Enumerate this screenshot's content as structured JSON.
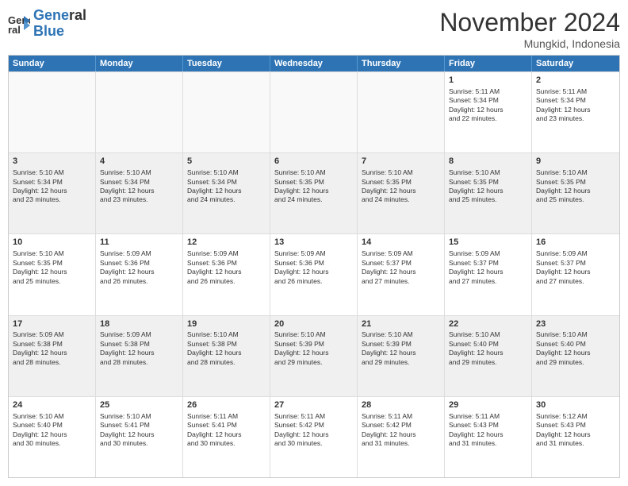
{
  "header": {
    "logo_line1": "General",
    "logo_line2": "Blue",
    "month_title": "November 2024",
    "location": "Mungkid, Indonesia"
  },
  "weekdays": [
    "Sunday",
    "Monday",
    "Tuesday",
    "Wednesday",
    "Thursday",
    "Friday",
    "Saturday"
  ],
  "rows": [
    [
      {
        "day": "",
        "info": ""
      },
      {
        "day": "",
        "info": ""
      },
      {
        "day": "",
        "info": ""
      },
      {
        "day": "",
        "info": ""
      },
      {
        "day": "",
        "info": ""
      },
      {
        "day": "1",
        "info": "Sunrise: 5:11 AM\nSunset: 5:34 PM\nDaylight: 12 hours\nand 22 minutes."
      },
      {
        "day": "2",
        "info": "Sunrise: 5:11 AM\nSunset: 5:34 PM\nDaylight: 12 hours\nand 23 minutes."
      }
    ],
    [
      {
        "day": "3",
        "info": "Sunrise: 5:10 AM\nSunset: 5:34 PM\nDaylight: 12 hours\nand 23 minutes."
      },
      {
        "day": "4",
        "info": "Sunrise: 5:10 AM\nSunset: 5:34 PM\nDaylight: 12 hours\nand 23 minutes."
      },
      {
        "day": "5",
        "info": "Sunrise: 5:10 AM\nSunset: 5:34 PM\nDaylight: 12 hours\nand 24 minutes."
      },
      {
        "day": "6",
        "info": "Sunrise: 5:10 AM\nSunset: 5:35 PM\nDaylight: 12 hours\nand 24 minutes."
      },
      {
        "day": "7",
        "info": "Sunrise: 5:10 AM\nSunset: 5:35 PM\nDaylight: 12 hours\nand 24 minutes."
      },
      {
        "day": "8",
        "info": "Sunrise: 5:10 AM\nSunset: 5:35 PM\nDaylight: 12 hours\nand 25 minutes."
      },
      {
        "day": "9",
        "info": "Sunrise: 5:10 AM\nSunset: 5:35 PM\nDaylight: 12 hours\nand 25 minutes."
      }
    ],
    [
      {
        "day": "10",
        "info": "Sunrise: 5:10 AM\nSunset: 5:35 PM\nDaylight: 12 hours\nand 25 minutes."
      },
      {
        "day": "11",
        "info": "Sunrise: 5:09 AM\nSunset: 5:36 PM\nDaylight: 12 hours\nand 26 minutes."
      },
      {
        "day": "12",
        "info": "Sunrise: 5:09 AM\nSunset: 5:36 PM\nDaylight: 12 hours\nand 26 minutes."
      },
      {
        "day": "13",
        "info": "Sunrise: 5:09 AM\nSunset: 5:36 PM\nDaylight: 12 hours\nand 26 minutes."
      },
      {
        "day": "14",
        "info": "Sunrise: 5:09 AM\nSunset: 5:37 PM\nDaylight: 12 hours\nand 27 minutes."
      },
      {
        "day": "15",
        "info": "Sunrise: 5:09 AM\nSunset: 5:37 PM\nDaylight: 12 hours\nand 27 minutes."
      },
      {
        "day": "16",
        "info": "Sunrise: 5:09 AM\nSunset: 5:37 PM\nDaylight: 12 hours\nand 27 minutes."
      }
    ],
    [
      {
        "day": "17",
        "info": "Sunrise: 5:09 AM\nSunset: 5:38 PM\nDaylight: 12 hours\nand 28 minutes."
      },
      {
        "day": "18",
        "info": "Sunrise: 5:09 AM\nSunset: 5:38 PM\nDaylight: 12 hours\nand 28 minutes."
      },
      {
        "day": "19",
        "info": "Sunrise: 5:10 AM\nSunset: 5:38 PM\nDaylight: 12 hours\nand 28 minutes."
      },
      {
        "day": "20",
        "info": "Sunrise: 5:10 AM\nSunset: 5:39 PM\nDaylight: 12 hours\nand 29 minutes."
      },
      {
        "day": "21",
        "info": "Sunrise: 5:10 AM\nSunset: 5:39 PM\nDaylight: 12 hours\nand 29 minutes."
      },
      {
        "day": "22",
        "info": "Sunrise: 5:10 AM\nSunset: 5:40 PM\nDaylight: 12 hours\nand 29 minutes."
      },
      {
        "day": "23",
        "info": "Sunrise: 5:10 AM\nSunset: 5:40 PM\nDaylight: 12 hours\nand 29 minutes."
      }
    ],
    [
      {
        "day": "24",
        "info": "Sunrise: 5:10 AM\nSunset: 5:40 PM\nDaylight: 12 hours\nand 30 minutes."
      },
      {
        "day": "25",
        "info": "Sunrise: 5:10 AM\nSunset: 5:41 PM\nDaylight: 12 hours\nand 30 minutes."
      },
      {
        "day": "26",
        "info": "Sunrise: 5:11 AM\nSunset: 5:41 PM\nDaylight: 12 hours\nand 30 minutes."
      },
      {
        "day": "27",
        "info": "Sunrise: 5:11 AM\nSunset: 5:42 PM\nDaylight: 12 hours\nand 30 minutes."
      },
      {
        "day": "28",
        "info": "Sunrise: 5:11 AM\nSunset: 5:42 PM\nDaylight: 12 hours\nand 31 minutes."
      },
      {
        "day": "29",
        "info": "Sunrise: 5:11 AM\nSunset: 5:43 PM\nDaylight: 12 hours\nand 31 minutes."
      },
      {
        "day": "30",
        "info": "Sunrise: 5:12 AM\nSunset: 5:43 PM\nDaylight: 12 hours\nand 31 minutes."
      }
    ]
  ]
}
